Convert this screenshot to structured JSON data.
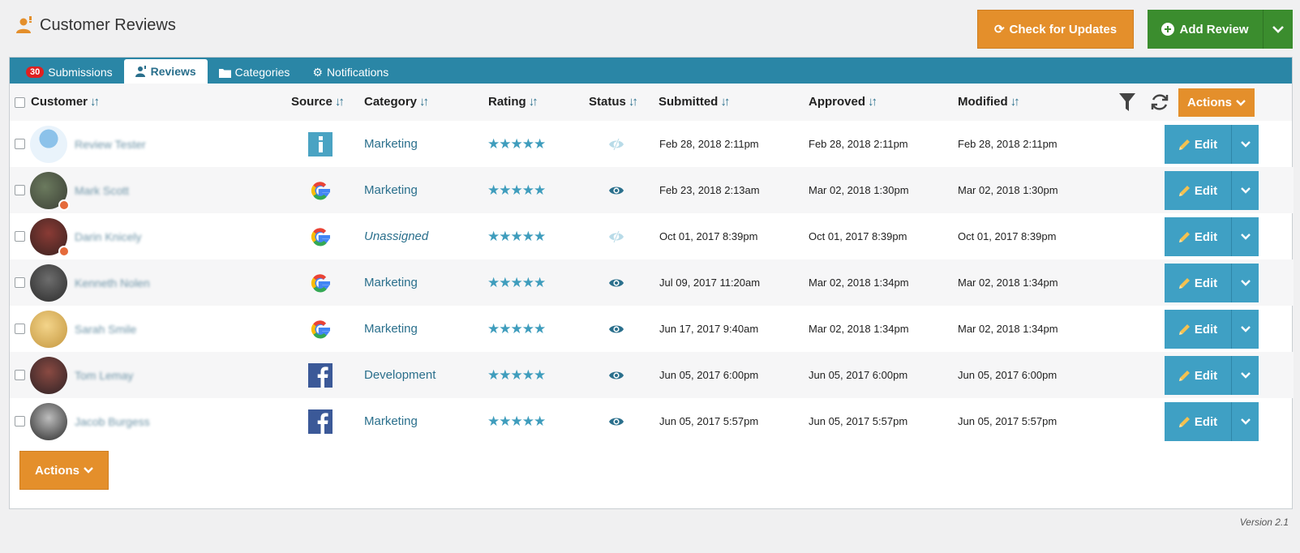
{
  "header": {
    "title": "Customer Reviews",
    "check_updates_label": "Check for Updates",
    "add_review_label": "Add Review"
  },
  "tabs": [
    {
      "label": "Submissions",
      "badge": "30",
      "active": false
    },
    {
      "label": "Reviews",
      "active": true
    },
    {
      "label": "Categories",
      "active": false
    },
    {
      "label": "Notifications",
      "active": false
    }
  ],
  "table": {
    "columns": {
      "customer": "Customer",
      "source": "Source",
      "category": "Category",
      "rating": "Rating",
      "status": "Status",
      "submitted": "Submitted",
      "approved": "Approved",
      "modified": "Modified"
    },
    "actions_label": "Actions",
    "edit_label": "Edit",
    "rows": [
      {
        "customer": "Review Tester",
        "source": "info",
        "category": "Marketing",
        "rating": 5,
        "status": "hidden",
        "submitted": "Feb 28, 2018 2:11pm",
        "approved": "Feb 28, 2018 2:11pm",
        "modified": "Feb 28, 2018 2:11pm"
      },
      {
        "customer": "Mark Scott",
        "source": "google",
        "category": "Marketing",
        "rating": 5,
        "status": "visible",
        "submitted": "Feb 23, 2018 2:13am",
        "approved": "Mar 02, 2018 1:30pm",
        "modified": "Mar 02, 2018 1:30pm"
      },
      {
        "customer": "Darin Knicely",
        "source": "google",
        "category": "Unassigned",
        "rating": 5,
        "status": "hidden",
        "submitted": "Oct 01, 2017 8:39pm",
        "approved": "Oct 01, 2017 8:39pm",
        "modified": "Oct 01, 2017 8:39pm"
      },
      {
        "customer": "Kenneth Nolen",
        "source": "google",
        "category": "Marketing",
        "rating": 5,
        "status": "visible",
        "submitted": "Jul 09, 2017 11:20am",
        "approved": "Mar 02, 2018 1:34pm",
        "modified": "Mar 02, 2018 1:34pm"
      },
      {
        "customer": "Sarah Smile",
        "source": "google",
        "category": "Marketing",
        "rating": 5,
        "status": "visible",
        "submitted": "Jun 17, 2017 9:40am",
        "approved": "Mar 02, 2018 1:34pm",
        "modified": "Mar 02, 2018 1:34pm"
      },
      {
        "customer": "Tom Lemay",
        "source": "facebook",
        "category": "Development",
        "rating": 5,
        "status": "visible",
        "submitted": "Jun 05, 2017 6:00pm",
        "approved": "Jun 05, 2017 6:00pm",
        "modified": "Jun 05, 2017 6:00pm"
      },
      {
        "customer": "Jacob Burgess",
        "source": "facebook",
        "category": "Marketing",
        "rating": 5,
        "status": "visible",
        "submitted": "Jun 05, 2017 5:57pm",
        "approved": "Jun 05, 2017 5:57pm",
        "modified": "Jun 05, 2017 5:57pm"
      }
    ]
  },
  "footer": {
    "actions_label": "Actions",
    "version": "Version 2.1"
  },
  "colors": {
    "accent": "#2a86a6",
    "orange": "#e48f2b",
    "green": "#3b8d2e",
    "edit_blue": "#3fa0c4"
  }
}
